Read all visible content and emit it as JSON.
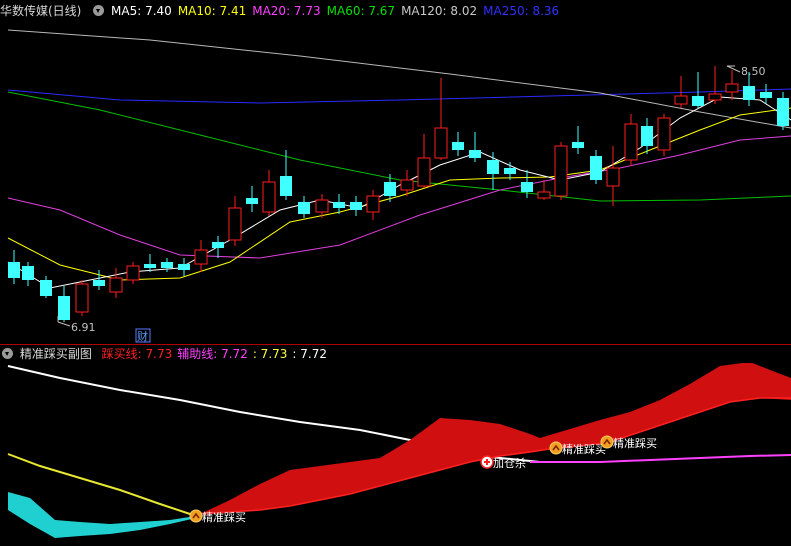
{
  "main_header": {
    "title": "华数传媒(日线)",
    "indicators": [
      {
        "label": "MA5: 7.40",
        "color": "#ffffff"
      },
      {
        "label": "MA10: 7.41",
        "color": "#ffff00"
      },
      {
        "label": "MA20: 7.73",
        "color": "#ff40ff"
      },
      {
        "label": "MA60: 7.67",
        "color": "#00e000"
      },
      {
        "label": "MA120: 8.02",
        "color": "#c8c8c8"
      },
      {
        "label": "MA250: 8.36",
        "color": "#3030ff"
      }
    ]
  },
  "main_chart": {
    "high_label": "8.50",
    "low_label": "6.91",
    "marker_label": "财"
  },
  "sub_header": {
    "title": "精准踩买副图",
    "items": [
      {
        "label": "踩买线: 7.73",
        "color": "#ff2020"
      },
      {
        "label": "辅助线: 7.72",
        "color": "#ff40ff"
      },
      {
        "label": ": 7.73",
        "color": "#ffff40"
      },
      {
        "label": ": 7.72",
        "color": "#ffffff"
      }
    ]
  },
  "signals": [
    {
      "label": "精准踩买",
      "kind": "buy"
    },
    {
      "label": "加仓杀",
      "kind": "add"
    },
    {
      "label": "精准踩买",
      "kind": "buy"
    },
    {
      "label": "精准踩买",
      "kind": "buy"
    }
  ],
  "colors": {
    "up": "#ff2020",
    "down": "#40ffff",
    "separator": "#b00000"
  }
}
